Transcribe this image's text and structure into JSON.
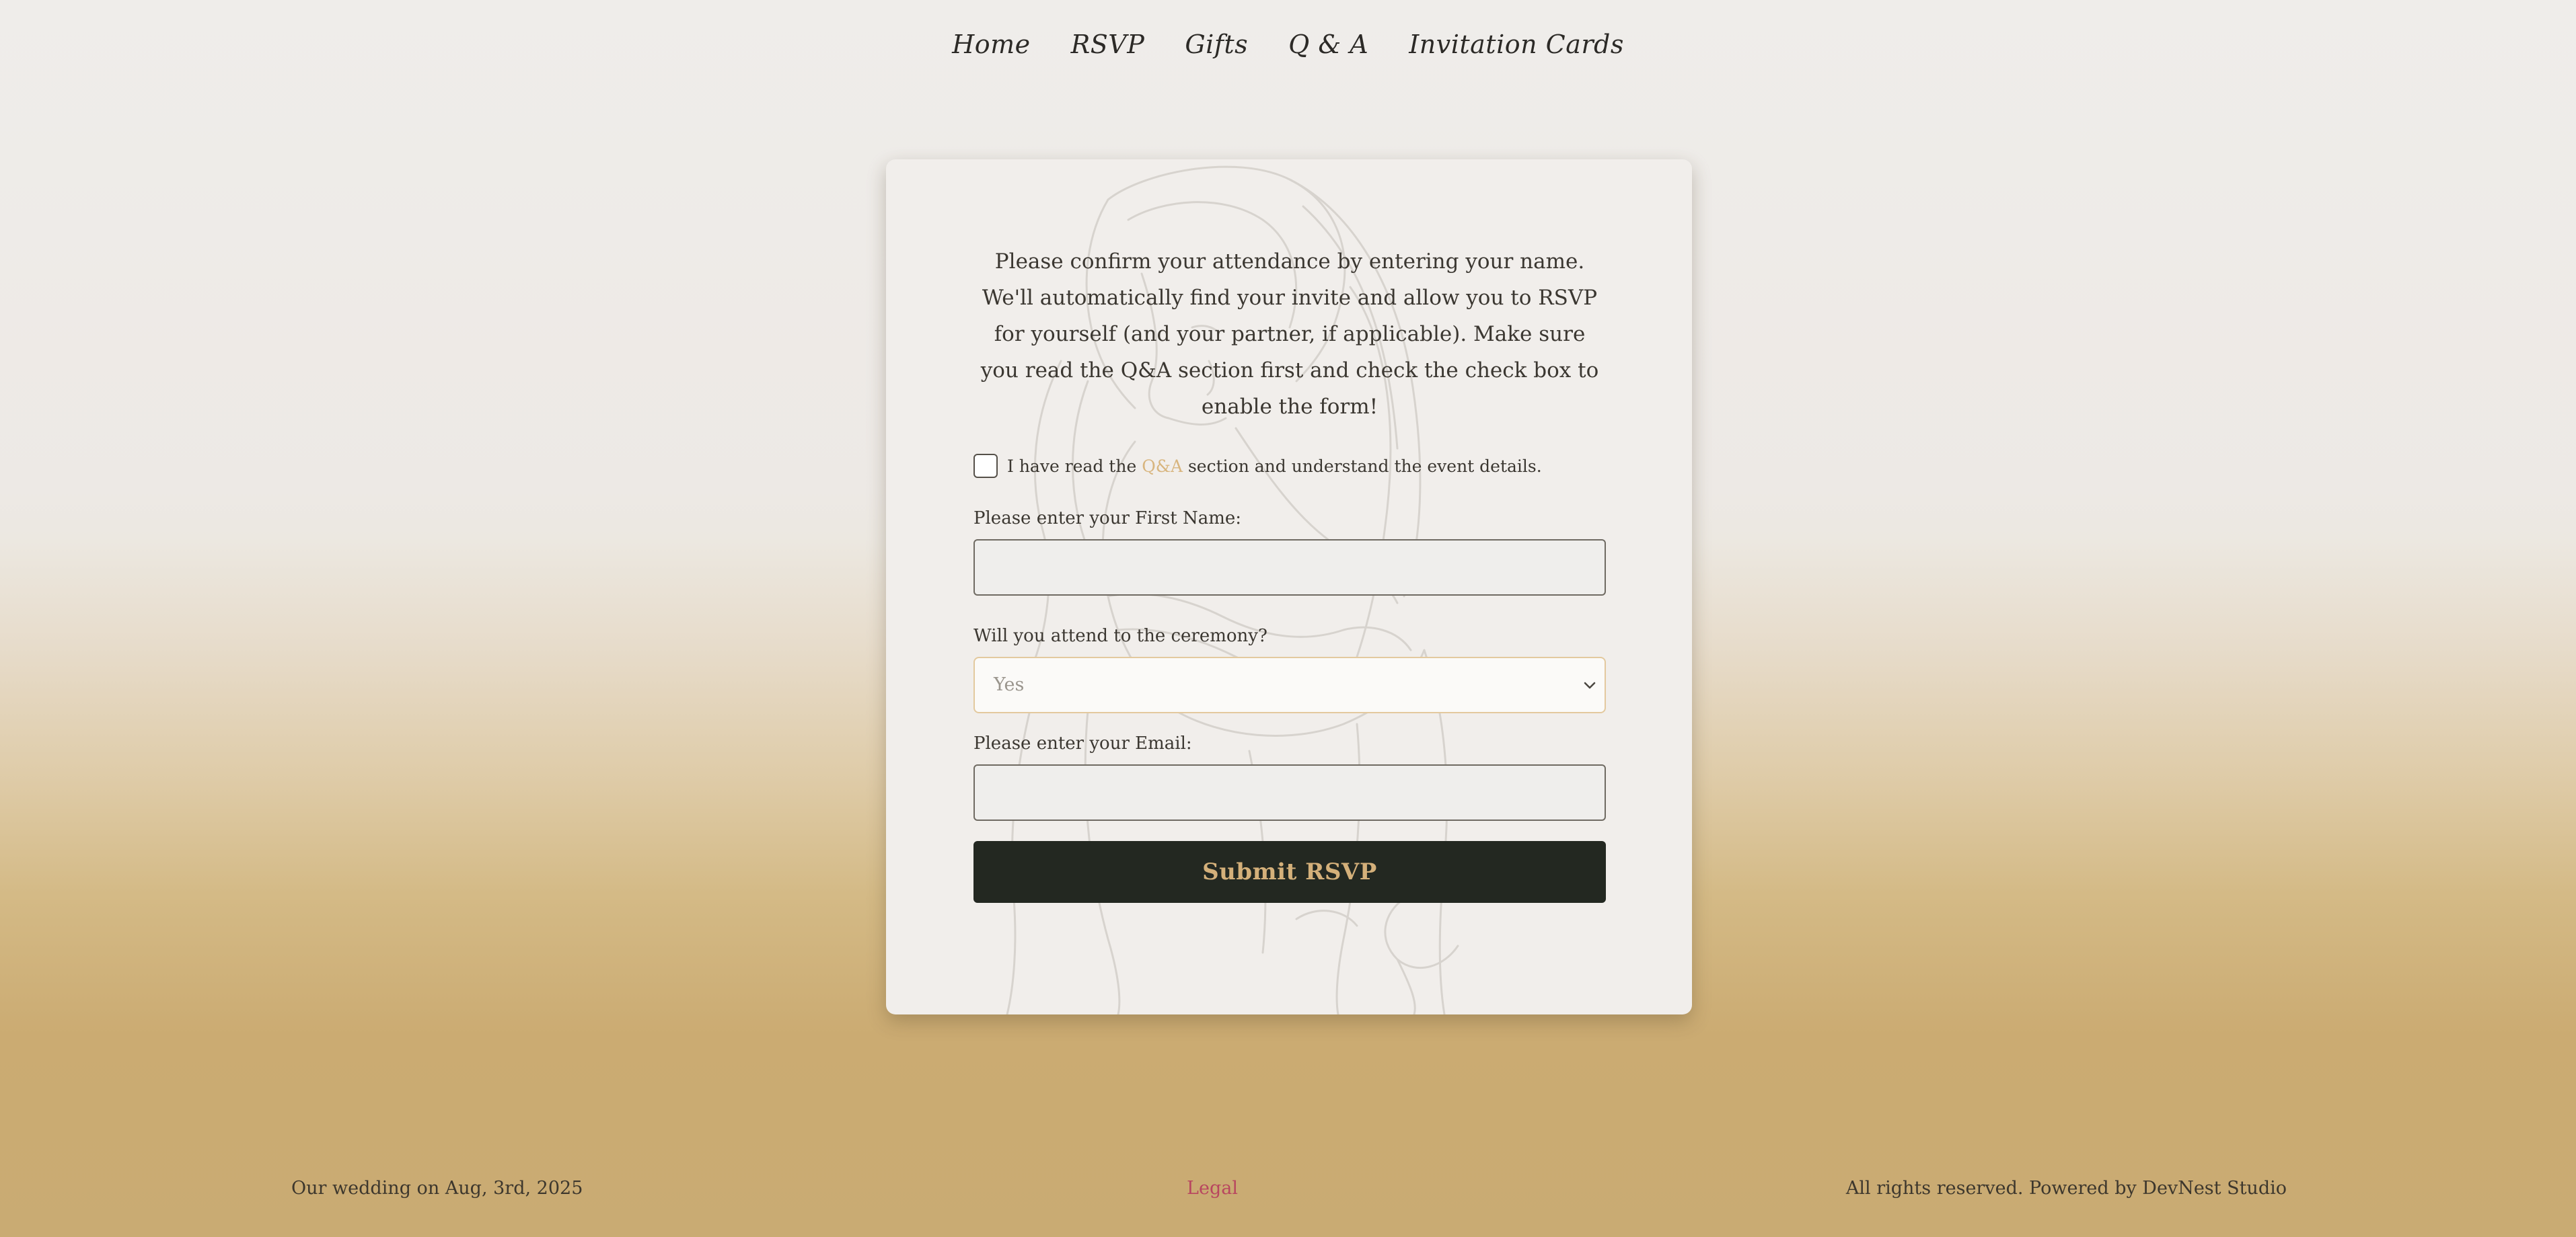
{
  "nav": {
    "items": [
      {
        "label": "Home"
      },
      {
        "label": "RSVP"
      },
      {
        "label": "Gifts"
      },
      {
        "label": "Q & A"
      },
      {
        "label": "Invitation Cards"
      }
    ]
  },
  "form": {
    "intro": "Please confirm your attendance by entering your name. We'll automatically find your invite and allow you to RSVP for yourself (and your partner, if applicable). Make sure you read the Q&A section first and check the check box to enable the form!",
    "consent": {
      "checked": false,
      "before": "I have read the",
      "link": "Q&A",
      "after": "section and understand the event details."
    },
    "first_name": {
      "label": "Please enter your First Name:",
      "value": ""
    },
    "attendance": {
      "label": "Will you attend to the ceremony?",
      "selected": "Yes"
    },
    "email": {
      "label": "Please enter your Email:",
      "value": ""
    },
    "submit_label": "Submit RSVP"
  },
  "footer": {
    "left": "Our wedding on Aug, 3rd, 2025",
    "center": "Legal",
    "right": "All rights reserved. Powered by DevNest Studio"
  },
  "colors": {
    "accent_gold": "#d4b07a",
    "button_dark": "#232821",
    "legal_link": "#b8465f",
    "background_top": "#efedea",
    "background_bottom": "#c9ab73"
  }
}
